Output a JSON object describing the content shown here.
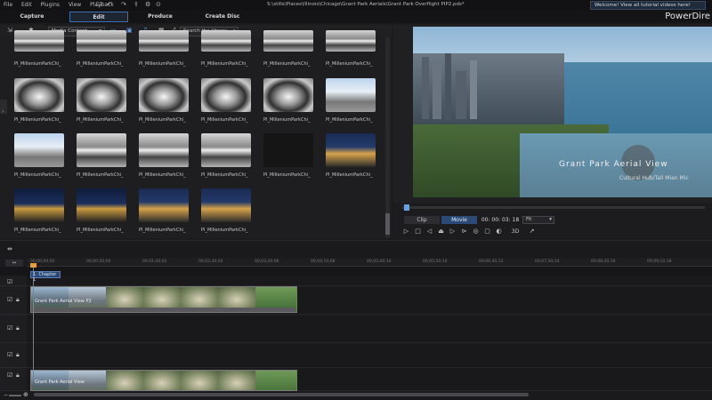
{
  "menu": [
    "File",
    "Edit",
    "Plugins",
    "View",
    "Playback"
  ],
  "window_title": "S:\\stills\\Places\\Illinois\\Chicago\\Grant Park Aerials\\Grant Park Overflight PIP2.pds*",
  "notification": "Welcome! View all tutorial videos here!",
  "app_name": "PowerDire",
  "mode_tabs": [
    "Capture",
    "Edit",
    "Produce",
    "Create Disc"
  ],
  "library": {
    "filter": "Media Content",
    "search_placeholder": "Search the library",
    "items": [
      {
        "label": "PI_MilleniumParkChi_",
        "kind": "bean"
      },
      {
        "label": "PI_MilleniumParkChi_",
        "kind": "bean"
      },
      {
        "label": "PI_MilleniumParkChi_",
        "kind": "bean"
      },
      {
        "label": "PI_MilleniumParkChi_",
        "kind": "bean"
      },
      {
        "label": "PI_MilleniumParkChi_",
        "kind": "bean"
      },
      {
        "label": "PI_MilleniumParkChi_",
        "kind": "bean"
      },
      {
        "label": "PI_MilleniumParkChi_",
        "kind": "bean2"
      },
      {
        "label": "PI_MilleniumParkChi_",
        "kind": "bean2"
      },
      {
        "label": "PI_MilleniumParkChi_",
        "kind": "bean2"
      },
      {
        "label": "PI_MilleniumParkChi_",
        "kind": "bean2"
      },
      {
        "label": "PI_MilleniumParkChi_",
        "kind": "bean2"
      },
      {
        "label": "PI_MilleniumParkChi_",
        "kind": "sky"
      },
      {
        "label": "PI_MilleniumParkChi_",
        "kind": "sky"
      },
      {
        "label": "PI_MilleniumParkChi_",
        "kind": "bean"
      },
      {
        "label": "PI_MilleniumParkChi_",
        "kind": "bean"
      },
      {
        "label": "PI_MilleniumParkChi_",
        "kind": "bean"
      },
      {
        "label": "PI_MilleniumParkChi_",
        "kind": "dark"
      },
      {
        "label": "PI_MilleniumParkChi_",
        "kind": "night"
      },
      {
        "label": "PI_MilleniumParkChi_",
        "kind": "night2"
      },
      {
        "label": "PI_MilleniumParkChi_",
        "kind": "night2"
      },
      {
        "label": "PI_MilleniumParkChi_",
        "kind": "night"
      },
      {
        "label": "PI_MilleniumParkChi_",
        "kind": "night"
      }
    ]
  },
  "preview": {
    "title_text": "Grant Park Aerial View",
    "subtitle_text": "Cultural Hub/Tall Mian Mic",
    "clip_label": "Clip",
    "movie_label": "Movie",
    "timecode": "00: 00: 03: 18",
    "fit_label": "Fit",
    "mode_3d": "3D"
  },
  "timeline": {
    "chapter_label": "1. Chapter 1",
    "ruler": [
      "00;00;00;00",
      "00;00;50;00",
      "00;01;40;02",
      "00;02;30;04",
      "00;03;20;06",
      "00;04;10;08",
      "00;05;00;10",
      "00;05;50;10",
      "00;06;40;12",
      "00;07;30;14",
      "00;08;20;16",
      "00;09;10;18"
    ],
    "clip1_label": "Grant Park Aerial View P2",
    "clip2_label": "Grant Park Aerial View"
  }
}
